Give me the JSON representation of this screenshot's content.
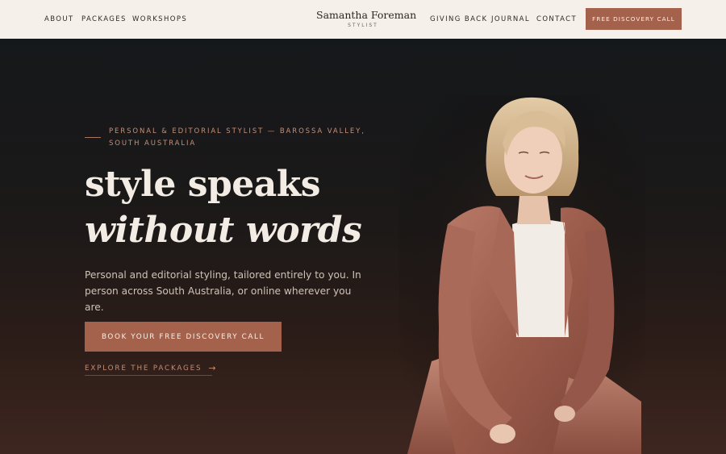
{
  "header": {
    "nav_left": [
      "ABOUT",
      "PACKAGES",
      "WORKSHOPS"
    ],
    "logo": {
      "name": "Samantha Foreman",
      "subtitle": "STYLIST"
    },
    "nav_right": [
      "GIVING BACK",
      "JOURNAL",
      "CONTACT"
    ],
    "cta_label": "FREE DISCOVERY CALL"
  },
  "hero": {
    "eyebrow": "PERSONAL & EDITORIAL STYLIST — BAROSSA VALLEY, SOUTH AUSTRALIA",
    "headline_line1": "style speaks",
    "headline_line2": "without words",
    "intro": "Personal and editorial styling, tailored entirely to you. In person across South Australia, or online wherever you are.",
    "primary_cta": "BOOK YOUR FREE DISCOVERY CALL",
    "secondary_cta": "EXPLORE THE PACKAGES",
    "secondary_icon": "arrow-right-icon"
  },
  "colors": {
    "header_bg": "#f5f0ea",
    "accent": "#a4624c",
    "hero_bg_top": "#15181b",
    "hero_bg_bottom": "#3e2620",
    "headline": "#f3ece4",
    "eyebrow": "#c59078"
  }
}
